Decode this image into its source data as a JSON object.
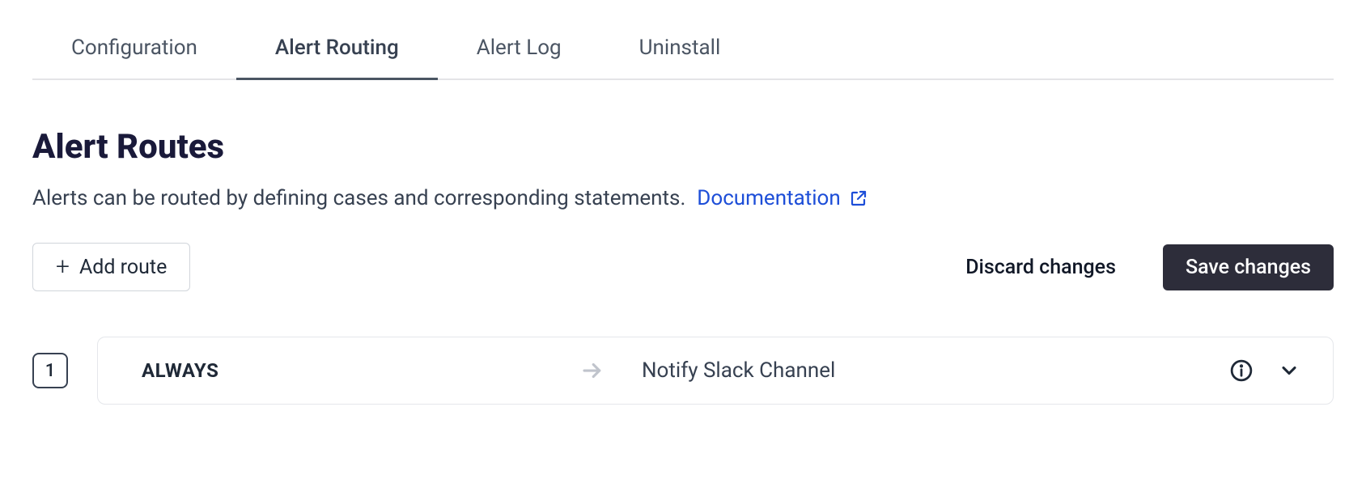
{
  "tabs": [
    {
      "label": "Configuration",
      "active": false
    },
    {
      "label": "Alert Routing",
      "active": true
    },
    {
      "label": "Alert Log",
      "active": false
    },
    {
      "label": "Uninstall",
      "active": false
    }
  ],
  "page": {
    "title": "Alert Routes",
    "subtitle": "Alerts can be routed by defining cases and corresponding statements.",
    "doc_link_label": "Documentation"
  },
  "actions": {
    "add_route_label": "Add route",
    "discard_label": "Discard changes",
    "save_label": "Save changes"
  },
  "routes": [
    {
      "number": "1",
      "condition": "ALWAYS",
      "action": "Notify Slack Channel"
    }
  ]
}
